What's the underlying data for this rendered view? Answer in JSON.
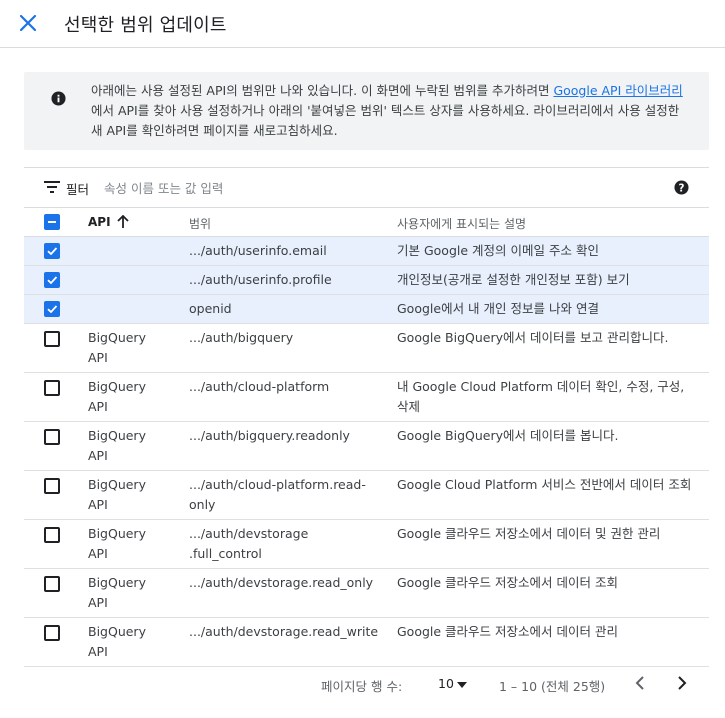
{
  "header": {
    "title": "선택한 범위 업데이트"
  },
  "info": {
    "text_before_link": "아래에는 사용 설정된 API의 범위만 나와 있습니다. 이 화면에 누락된 범위를 추가하려면 ",
    "link_text": "Google API 라이브러리",
    "text_after_link": "에서 API를 찾아 사용 설정하거나 아래의 '붙여넣은 범위' 텍스트 상자를 사용하세요. 라이브러리에서 사용 설정한 새 API를 확인하려면 페이지를 새로고침하세요."
  },
  "filter": {
    "label": "필터",
    "placeholder": "속성 이름 또는 값 입력"
  },
  "table": {
    "columns": {
      "api": "API",
      "scope": "범위",
      "description": "사용자에게 표시되는 설명"
    },
    "rows": [
      {
        "checked": true,
        "api": "",
        "scope": ".../auth/userinfo.email",
        "description": "기본 Google 계정의 이메일 주소 확인"
      },
      {
        "checked": true,
        "api": "",
        "scope": ".../auth/userinfo.profile",
        "description": "개인정보(공개로 설정한 개인정보 포함) 보기"
      },
      {
        "checked": true,
        "api": "",
        "scope": "openid",
        "description": "Google에서 내 개인 정보를 나와 연결"
      },
      {
        "checked": false,
        "api": "BigQuery API",
        "scope": ".../auth/bigquery",
        "description": "Google BigQuery에서 데이터를 보고 관리합니다."
      },
      {
        "checked": false,
        "api": "BigQuery API",
        "scope": ".../auth/cloud-platform",
        "description": "내 Google Cloud Platform 데이터 확인, 수정, 구성, 삭제"
      },
      {
        "checked": false,
        "api": "BigQuery API",
        "scope": ".../auth/bigquery.readonly",
        "description": "Google BigQuery에서 데이터를 봅니다."
      },
      {
        "checked": false,
        "api": "BigQuery API",
        "scope": ".../auth/cloud-platform.read-only",
        "description": "Google Cloud Platform 서비스 전반에서 데이터 조회"
      },
      {
        "checked": false,
        "api": "BigQuery API",
        "scope": ".../auth/devstorage .full_control",
        "description": "Google 클라우드 저장소에서 데이터 및 권한 관리"
      },
      {
        "checked": false,
        "api": "BigQuery API",
        "scope": ".../auth/devstorage.read_only",
        "description": "Google 클라우드 저장소에서 데이터 조회"
      },
      {
        "checked": false,
        "api": "BigQuery API",
        "scope": ".../auth/devstorage.read_write",
        "description": "Google 클라우드 저장소에서 데이터 관리"
      }
    ]
  },
  "pager": {
    "rows_per_page_label": "페이지당 행 수:",
    "rows_per_page": "10",
    "range": "1 – 10 (전체 25행)"
  },
  "colors": {
    "accent": "#1a73e8",
    "selected_row": "#e8f0fe",
    "info_bg": "#f1f3f4"
  },
  "icons": {
    "close": "close-icon",
    "info": "info-icon",
    "filter": "filter-icon",
    "help": "help-icon",
    "sort": "arrow-up-icon",
    "prev": "chevron-left-icon",
    "next": "chevron-right-icon"
  }
}
